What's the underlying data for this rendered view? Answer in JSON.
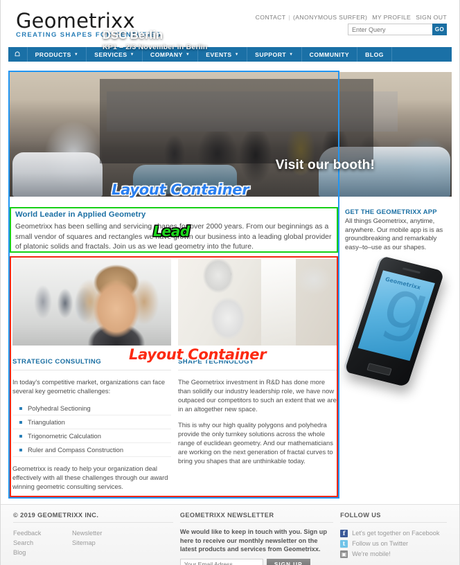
{
  "header": {
    "logo": "Geometrixx",
    "tagline": "CREATING SHAPES FOR CENTURIES",
    "util": {
      "contact": "CONTACT",
      "separator": "|",
      "user": "(ANONYMOUS SURFER)",
      "profile": "MY PROFILE",
      "signout": "SIGN OUT"
    },
    "search": {
      "placeholder": "Enter Query",
      "value": "",
      "button": "GO"
    }
  },
  "nav": {
    "home_icon": "home-icon",
    "items": [
      {
        "label": "PRODUCTS",
        "caret": "▼"
      },
      {
        "label": "SERVICES",
        "caret": "▼"
      },
      {
        "label": "COMPANY",
        "caret": "▼"
      },
      {
        "label": "EVENTS",
        "caret": "▼"
      },
      {
        "label": "SUPPORT",
        "caret": "▼"
      },
      {
        "label": "COMMUNITY",
        "caret": ""
      },
      {
        "label": "BLOG",
        "caret": ""
      }
    ]
  },
  "hero": {
    "title": "DSC Berlin",
    "subtitle": "KP1 – 2/3 November in Berlin",
    "cta": "Visit our booth!"
  },
  "overlays": {
    "hero_container": "Layout Container",
    "lead": "Lead",
    "par_container": "Layout Container"
  },
  "lead": {
    "heading": "World Leader in Applied Geometry",
    "body": "Geometrixx has been selling and servicing shapes for over 2000 years. From our beginnings as a small vendor of squares and rectangles we have grown our business into a leading global provider of platonic solids and fractals. Join us as we lead geometry into the future."
  },
  "rail": {
    "heading": "GET THE GEOMETRIXX APP",
    "body": "All things Geometrixx, anytime, anywhere. Our mobile app is is as groundbreaking and remarkably easy–to–use as our shapes.",
    "phone_brand": "Geometrixx",
    "phone_logo": "g"
  },
  "columns": [
    {
      "image_name": "consulting-photo",
      "heading": "STRATEGIC CONSULTING",
      "intro": "In today's competitive market, organizations can face several key geometric challenges:",
      "items": [
        "Polyhedral Sectioning",
        "Triangulation",
        "Trigonometric Calculation",
        "Ruler and Compass Construction"
      ],
      "outro": "Geometrixx is ready to help your organization deal effectively with all these challenges through our award winning geometric consulting services."
    },
    {
      "image_name": "cleanroom-photo",
      "heading": "SHAPE TECHNOLOGY",
      "paragraph1": "The Geometrixx investment in R&D has done more than solidify our industry leadership role, we have now outpaced our competitors to such an extent that we are in an altogether new space.",
      "paragraph2": "This is why our high quality polygons and polyhedra provide the only turnkey solutions across the whole range of euclidean geometry. And our mathematicians are working on the next generation of fractal curves to bring you shapes that are unthinkable today."
    }
  ],
  "footer": {
    "copyright": "© 2019 GEOMETRIXX INC.",
    "links_col1": [
      "Feedback",
      "Search",
      "Blog"
    ],
    "links_col2": [
      "Newsletter",
      "Sitemap"
    ],
    "newsletter": {
      "heading": "GEOMETRIXX NEWSLETTER",
      "body": "We would like to keep in touch with you. Sign up here to receive our monthly newsletter on the latest products and services from Geometrixx.",
      "placeholder": "Your Email Adress",
      "value": "",
      "button": "SIGN UP"
    },
    "follow": {
      "heading": "FOLLOW US",
      "items": [
        {
          "icon": "facebook-icon",
          "glyph": "f",
          "label": "Let's get together on Facebook",
          "color": "#3b5998"
        },
        {
          "icon": "twitter-icon",
          "glyph": "t",
          "label": "Follow us on Twitter",
          "color": "#6fc3e8"
        },
        {
          "icon": "mobile-icon",
          "glyph": "▣",
          "label": "We're mobile!",
          "color": "#8d8d8d"
        }
      ]
    }
  },
  "colors": {
    "brand_blue": "#1a70a6",
    "accent_blue": "#2a7fb8",
    "overlay_blue": "#2196f3",
    "overlay_green": "#16d016",
    "overlay_red": "#f22712"
  }
}
